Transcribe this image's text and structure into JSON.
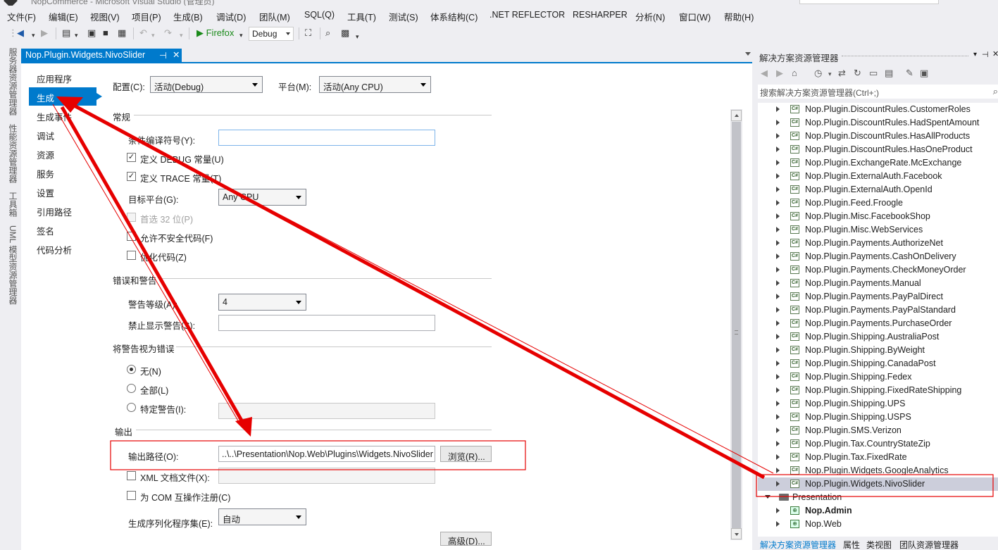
{
  "titlebar": {
    "text": "NopCommerce - Microsoft Visual Studio (管理员)"
  },
  "menu": [
    "文件(F)",
    "编辑(E)",
    "视图(V)",
    "项目(P)",
    "生成(B)",
    "调试(D)",
    "团队(M)",
    "SQL(Q)",
    "工具(T)",
    "测试(S)",
    "体系结构(C)",
    ".NET REFLECTOR",
    "RESHARPER",
    "分析(N)",
    "窗口(W)",
    "帮助(H)"
  ],
  "toolbar": {
    "run_label": "▶ Firefox",
    "config_value": "Debug"
  },
  "left_tool_tabs": [
    "服务器资源管理器",
    "性能资源管理器",
    "工具箱",
    "UML 模型资源管理器"
  ],
  "document_tab": {
    "title": "Nop.Plugin.Widgets.NivoSlider",
    "pin": "⊣",
    "close": "✕"
  },
  "nav": {
    "items": [
      "应用程序",
      "生成",
      "生成事件",
      "调试",
      "资源",
      "服务",
      "设置",
      "引用路径",
      "签名",
      "代码分析"
    ],
    "selected": "生成"
  },
  "config": {
    "config_label": "配置(C):",
    "config_value": "活动(Debug)",
    "platform_label": "平台(M):",
    "platform_value": "活动(Any CPU)"
  },
  "general": {
    "title": "常规",
    "conditional_label": "条件编译符号(Y):",
    "conditional_value": "",
    "debug_const": "定义 DEBUG 常量(U)",
    "trace_const": "定义 TRACE 常量(T)",
    "target_label": "目标平台(G):",
    "target_value": "Any CPU",
    "prefer32": "首选 32 位(P)",
    "unsafe": "允许不安全代码(F)",
    "optimize": "优化代码(Z)"
  },
  "errors": {
    "title": "错误和警告",
    "warn_level_label": "警告等级(A):",
    "warn_level_value": "4",
    "suppress_label": "禁止显示警告(S):",
    "suppress_value": ""
  },
  "treat_warnings": {
    "title": "将警告视为错误",
    "none": "无(N)",
    "all": "全部(L)",
    "specific": "特定警告(I):",
    "specific_value": ""
  },
  "output": {
    "title": "输出",
    "path_label": "输出路径(O):",
    "path_value": "..\\..\\Presentation\\Nop.Web\\Plugins\\Widgets.NivoSlider",
    "browse": "浏览(R)...",
    "xml_doc": "XML 文档文件(X):",
    "xml_value": "",
    "com": "为 COM 互操作注册(C)",
    "serialization_label": "生成序列化程序集(E):",
    "serialization_value": "自动",
    "advanced": "高级(D)..."
  },
  "solution_explorer": {
    "title": "解决方案资源管理器",
    "search_placeholder": "搜索解决方案资源管理器(Ctrl+;)",
    "items": [
      "Nop.Plugin.DiscountRules.CustomerRoles",
      "Nop.Plugin.DiscountRules.HadSpentAmount",
      "Nop.Plugin.DiscountRules.HasAllProducts",
      "Nop.Plugin.DiscountRules.HasOneProduct",
      "Nop.Plugin.ExchangeRate.McExchange",
      "Nop.Plugin.ExternalAuth.Facebook",
      "Nop.Plugin.ExternalAuth.OpenId",
      "Nop.Plugin.Feed.Froogle",
      "Nop.Plugin.Misc.FacebookShop",
      "Nop.Plugin.Misc.WebServices",
      "Nop.Plugin.Payments.AuthorizeNet",
      "Nop.Plugin.Payments.CashOnDelivery",
      "Nop.Plugin.Payments.CheckMoneyOrder",
      "Nop.Plugin.Payments.Manual",
      "Nop.Plugin.Payments.PayPalDirect",
      "Nop.Plugin.Payments.PayPalStandard",
      "Nop.Plugin.Payments.PurchaseOrder",
      "Nop.Plugin.Shipping.AustraliaPost",
      "Nop.Plugin.Shipping.ByWeight",
      "Nop.Plugin.Shipping.CanadaPost",
      "Nop.Plugin.Shipping.Fedex",
      "Nop.Plugin.Shipping.FixedRateShipping",
      "Nop.Plugin.Shipping.UPS",
      "Nop.Plugin.Shipping.USPS",
      "Nop.Plugin.SMS.Verizon",
      "Nop.Plugin.Tax.CountryStateZip",
      "Nop.Plugin.Tax.FixedRate",
      "Nop.Plugin.Widgets.GoogleAnalytics",
      "Nop.Plugin.Widgets.NivoSlider"
    ],
    "selected_item": "Nop.Plugin.Widgets.NivoSlider",
    "folder": "Presentation",
    "folder_items": [
      "Nop.Admin",
      "Nop.Web"
    ],
    "bottom_tabs": [
      "解决方案资源管理器",
      "属性",
      "类视图",
      "团队资源管理器"
    ]
  },
  "colors": {
    "accent": "#007acc",
    "annotation": "#ff0000"
  }
}
